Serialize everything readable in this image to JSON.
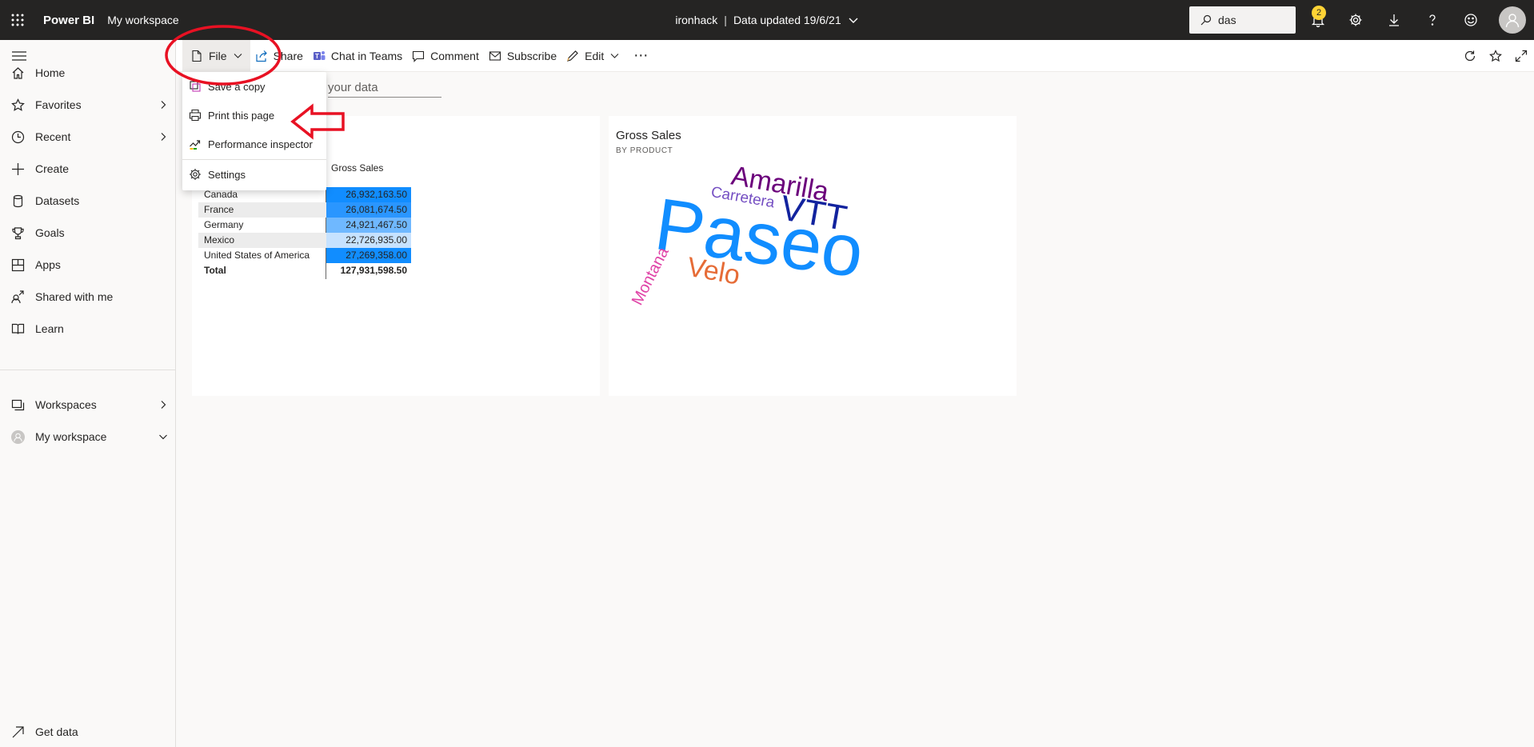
{
  "app": {
    "brand": "Power BI",
    "workspace_crumb": "My workspace"
  },
  "header": {
    "report": "ironhack",
    "separator": "|",
    "data_updated": "Data updated 19/6/21"
  },
  "search": {
    "value": "das"
  },
  "notifications": {
    "count": "2"
  },
  "nav": {
    "items": [
      {
        "label": "Home",
        "icon": "home-icon"
      },
      {
        "label": "Favorites",
        "icon": "star-icon"
      },
      {
        "label": "Recent",
        "icon": "clock-icon"
      },
      {
        "label": "Create",
        "icon": "plus-icon"
      },
      {
        "label": "Datasets",
        "icon": "database-icon"
      },
      {
        "label": "Goals",
        "icon": "trophy-icon"
      },
      {
        "label": "Apps",
        "icon": "apps-icon"
      },
      {
        "label": "Shared with me",
        "icon": "shared-icon"
      },
      {
        "label": "Learn",
        "icon": "book-icon"
      }
    ],
    "workspaces": "Workspaces",
    "my_workspace": "My workspace",
    "get_data": "Get data"
  },
  "actionbar": {
    "file": "File",
    "share": "Share",
    "chat": "Chat in Teams",
    "comment": "Comment",
    "subscribe": "Subscribe",
    "edit": "Edit",
    "more": "⋯"
  },
  "file_menu": {
    "items": [
      "Save a copy",
      "Print this page",
      "Performance inspector",
      "Settings"
    ]
  },
  "filter": {
    "text": "your data"
  },
  "tile_table": {
    "column_header": "Gross Sales",
    "rows": [
      {
        "country": "Canada",
        "value": "26,932,163.50"
      },
      {
        "country": "France",
        "value": "26,081,674.50"
      },
      {
        "country": "Germany",
        "value": "24,921,467.50"
      },
      {
        "country": "Mexico",
        "value": "22,726,935.00"
      },
      {
        "country": "United States of America",
        "value": "27,269,358.00"
      }
    ],
    "total_label": "Total",
    "total_value": "127,931,598.50",
    "row_colors": [
      "#118dff",
      "#2a96ff",
      "#6fb8ff",
      "#c6e2ff",
      "#118dff"
    ]
  },
  "tile_wordcloud": {
    "title": "Gross Sales",
    "subtitle": "BY PRODUCT",
    "words": [
      {
        "text": "Paseo",
        "color": "#118dff"
      },
      {
        "text": "Amarilla",
        "color": "#6b007b"
      },
      {
        "text": "VTT",
        "color": "#12239e"
      },
      {
        "text": "Carretera",
        "color": "#744ec2"
      },
      {
        "text": "Velo",
        "color": "#e66c37"
      },
      {
        "text": "Montana",
        "color": "#e044a7"
      }
    ]
  },
  "annotation_colors": {
    "highlight": "#e81123"
  }
}
